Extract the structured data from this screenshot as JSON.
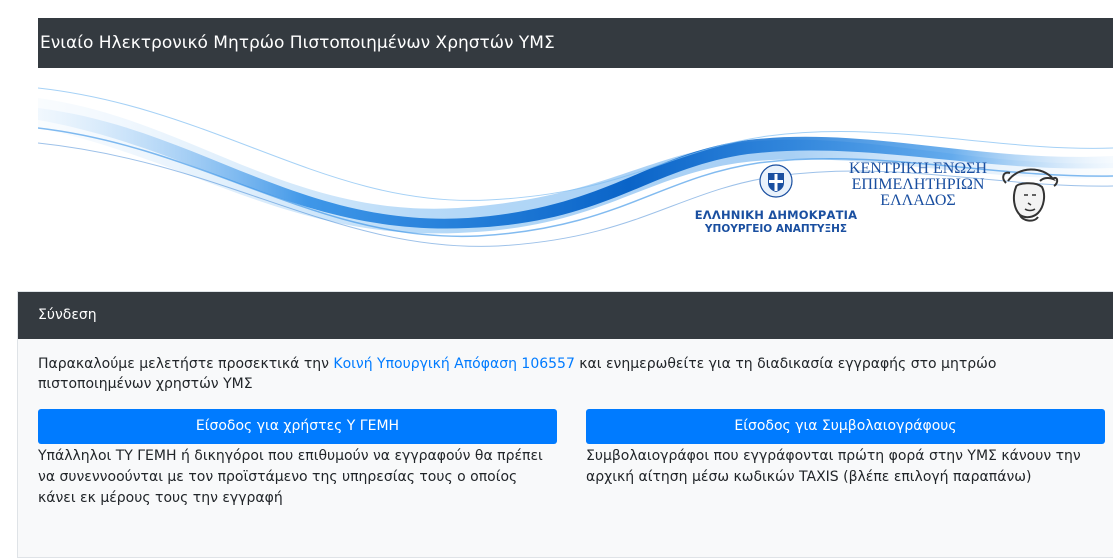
{
  "header": {
    "title": "Ενιαίο Ηλεκτρονικό Μητρώο Πιστοποιημένων Χρηστών ΥΜΣ"
  },
  "banner": {
    "gov_line1": "ΕΛΛΗΝΙΚΗ ΔΗΜΟΚΡΑΤΙΑ",
    "gov_line2": "ΥΠΟΥΡΓΕΙΟ ΑΝΑΠΤΥΞΗΣ",
    "chamber_line1": "ΚΕΝΤΡΙΚΗ ΕΝΩΣΗ",
    "chamber_line2": "ΕΠΙΜΕΛΗΤΗΡΙΩΝ",
    "chamber_line3": "ΕΛΛΑΔΟΣ",
    "wave_colors": [
      "#0a64c8",
      "#2f8ee6",
      "#7fbdf2",
      "#cfe6fb"
    ]
  },
  "login": {
    "header": "Σύνδεση",
    "intro_before": "Παρακαλούμε μελετήστε προσεκτικά την ",
    "intro_link": "Κοινή Υπουργική Απόφαση 106557",
    "intro_after": " και ενημερωθείτε για τη διαδικασία εγγραφής στο μητρώο πιστοποιημένων χρηστών ΥΜΣ",
    "left_button": "Είσοδος για χρήστες Υ ΓΕΜΗ",
    "left_desc": "Υπάλληλοι ΤΥ ΓΕΜΗ ή δικηγόροι που επιθυμούν να εγγραφούν θα πρέπει να συνεννοούνται με τον προϊστάμενο της υπηρεσίας τους ο οποίος κάνει εκ μέρους τους την εγγραφή",
    "right_button": "Είσοδος για Συμβολαιογράφους",
    "right_desc": "Συμβολαιογράφοι που εγγράφονται πρώτη φορά στην ΥΜΣ κάνουν την αρχική αίτηση μέσω κωδικών TAXIS (βλέπε επιλογή παραπάνω)"
  },
  "colors": {
    "navbar": "#343a40",
    "primary": "#007bff",
    "logo_blue": "#1a4fa0",
    "card_bg": "#f8f9fa"
  }
}
